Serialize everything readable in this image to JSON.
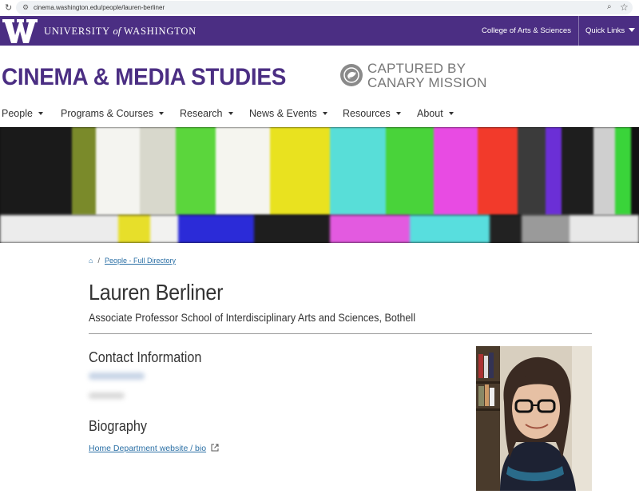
{
  "browser": {
    "url": "cinema.washington.edu/people/lauren-berliner"
  },
  "uw_bar": {
    "wordmark_pre": "UNIVERSITY",
    "wordmark_of": "of",
    "wordmark_post": "WASHINGTON",
    "college_link": "College of Arts & Sciences",
    "quick_links": "Quick Links"
  },
  "header": {
    "site_title": "CINEMA & MEDIA STUDIES",
    "overlay_line1": "CAPTURED BY",
    "overlay_line2": "CANARY MISSION"
  },
  "nav": {
    "items": [
      {
        "label": "People"
      },
      {
        "label": "Programs & Courses"
      },
      {
        "label": "Research"
      },
      {
        "label": "News & Events"
      },
      {
        "label": "Resources"
      },
      {
        "label": "About"
      }
    ]
  },
  "breadcrumb": {
    "directory": "People - Full Directory"
  },
  "profile": {
    "name": "Lauren Berliner",
    "title": "Associate Professor School of Interdisciplinary Arts and Sciences, Bothell",
    "contact_heading": "Contact Information",
    "bio_heading": "Biography",
    "bio_link": "Home Department website / bio"
  },
  "colors": {
    "uw_purple": "#4b2e83",
    "link_blue": "#2a6fa5"
  }
}
